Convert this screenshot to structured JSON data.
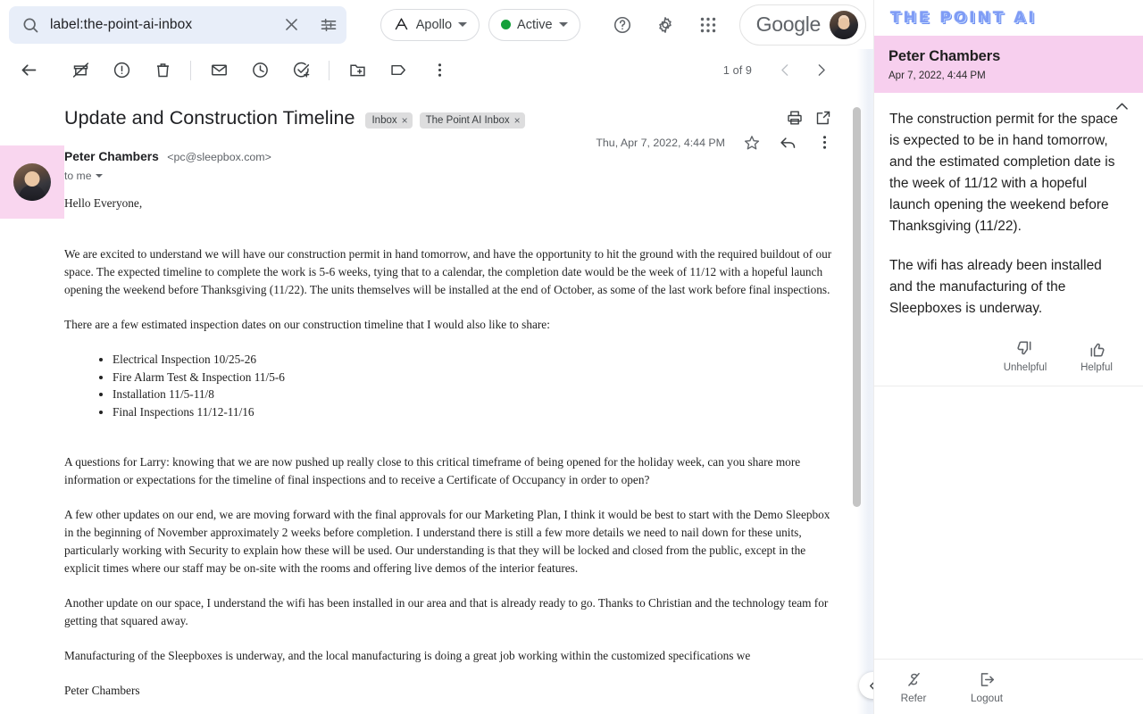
{
  "search": {
    "value": "label:the-point-ai-inbox",
    "icon": "search-icon",
    "clear_icon": "close-icon",
    "filter_icon": "filter-options-icon"
  },
  "header": {
    "account_chip": {
      "label": "Apollo",
      "icon": "apollo-logo-icon"
    },
    "status_chip": {
      "label": "Active",
      "dot_color": "#14a03a"
    },
    "help_icon": "help-circle-icon",
    "settings_icon": "gear-icon",
    "apps_icon": "apps-grid-icon",
    "brand": "Google",
    "avatar": "user-avatar"
  },
  "toolbar": {
    "back": "back-arrow-icon",
    "archive": "archive-icon",
    "spam": "report-spam-icon",
    "delete": "trash-icon",
    "unread": "mark-unread-envelope-icon",
    "snooze": "clock-snooze-icon",
    "tasks": "add-to-tasks-icon",
    "move": "move-to-folder-icon",
    "label": "label-tag-icon",
    "more": "more-vertical-icon",
    "pagination": "1 of 9",
    "prev": "chevron-left-icon",
    "next": "chevron-right-icon"
  },
  "email": {
    "subject": "Update and Construction Timeline",
    "labels": [
      {
        "name": "Inbox",
        "remove": "×"
      },
      {
        "name": "The Point AI Inbox",
        "remove": "×"
      }
    ],
    "print_icon": "print-icon",
    "popout_icon": "open-in-new-window-icon",
    "sender_name": "Peter Chambers",
    "sender_email": "<pc@sleepbox.com>",
    "recipient": "to me",
    "date": "Thu, Apr 7, 2022, 4:44 PM",
    "star_icon": "star-icon",
    "reply_icon": "reply-arrow-icon",
    "more_icon": "more-vertical-icon",
    "greeting": "Hello Everyone,",
    "para1": "We are excited to understand we will have our construction permit in hand tomorrow, and have the opportunity to hit the ground with the required buildout of our space.  The expected timeline to complete the work is 5-6 weeks, tying that to a calendar, the completion date would be the week of 11/12 with a hopeful launch opening the weekend before Thanksgiving (11/22).  The units themselves will be installed at the end of October, as some of the last work before final inspections.",
    "para2": "There are a few estimated inspection dates on our construction timeline that I would also like to share:",
    "bullets": [
      "Electrical Inspection 10/25-26",
      "Fire Alarm Test & Inspection 11/5-6",
      "Installation 11/5-11/8",
      "Final Inspections 11/12-11/16"
    ],
    "para3": "A questions for Larry: knowing that we are now pushed up really close to this critical timeframe of being opened for the holiday week, can you share more information or expectations for the timeline of final inspections and to receive a Certificate of Occupancy in order to open?",
    "para4": "A few other updates on our end, we are moving forward with the final approvals for our Marketing Plan, I think it would be best to start with the Demo Sleepbox in the beginning of November approximately 2 weeks before completion.  I understand there is still a few more details we need to nail down for these units, particularly working with Security to explain how these will be used.  Our understanding is that they will be locked and closed from the public, except in the explicit times where our staff may be on-site with the rooms and offering live demos of the interior features.",
    "para5": "Another update on our space, I understand the wifi has been installed in our area and that is already ready to go.  Thanks to Christian and the technology team for getting that squared away.",
    "para6": "Manufacturing of the Sleepboxes is underway, and the local manufacturing is doing a great job working within the customized specifications we",
    "signature": "Peter Chambers"
  },
  "panel": {
    "logo": "THE POINT AI",
    "card_name": "Peter Chambers",
    "card_date": "Apr 7, 2022, 4:44 PM",
    "collapse_icon": "chevron-up-icon",
    "summary1": "The construction permit for the space is expected to be in hand tomorrow, and the estimated completion date is the week of 11/12 with a hopeful launch opening the weekend before Thanksgiving (11/22).",
    "summary2": "The wifi has already been installed and the manufacturing of the Sleepboxes is underway.",
    "unhelpful_label": "Unhelpful",
    "helpful_label": "Helpful",
    "unhelpful_icon": "thumb-down-icon",
    "helpful_icon": "thumb-up-icon",
    "refer_label": "Refer",
    "logout_label": "Logout",
    "refer_icon": "refer-dollar-icon",
    "logout_icon": "logout-icon",
    "header_bg": "#f7cfee"
  },
  "mail_pane": {
    "collapse_icon": "chevron-left-icon"
  }
}
